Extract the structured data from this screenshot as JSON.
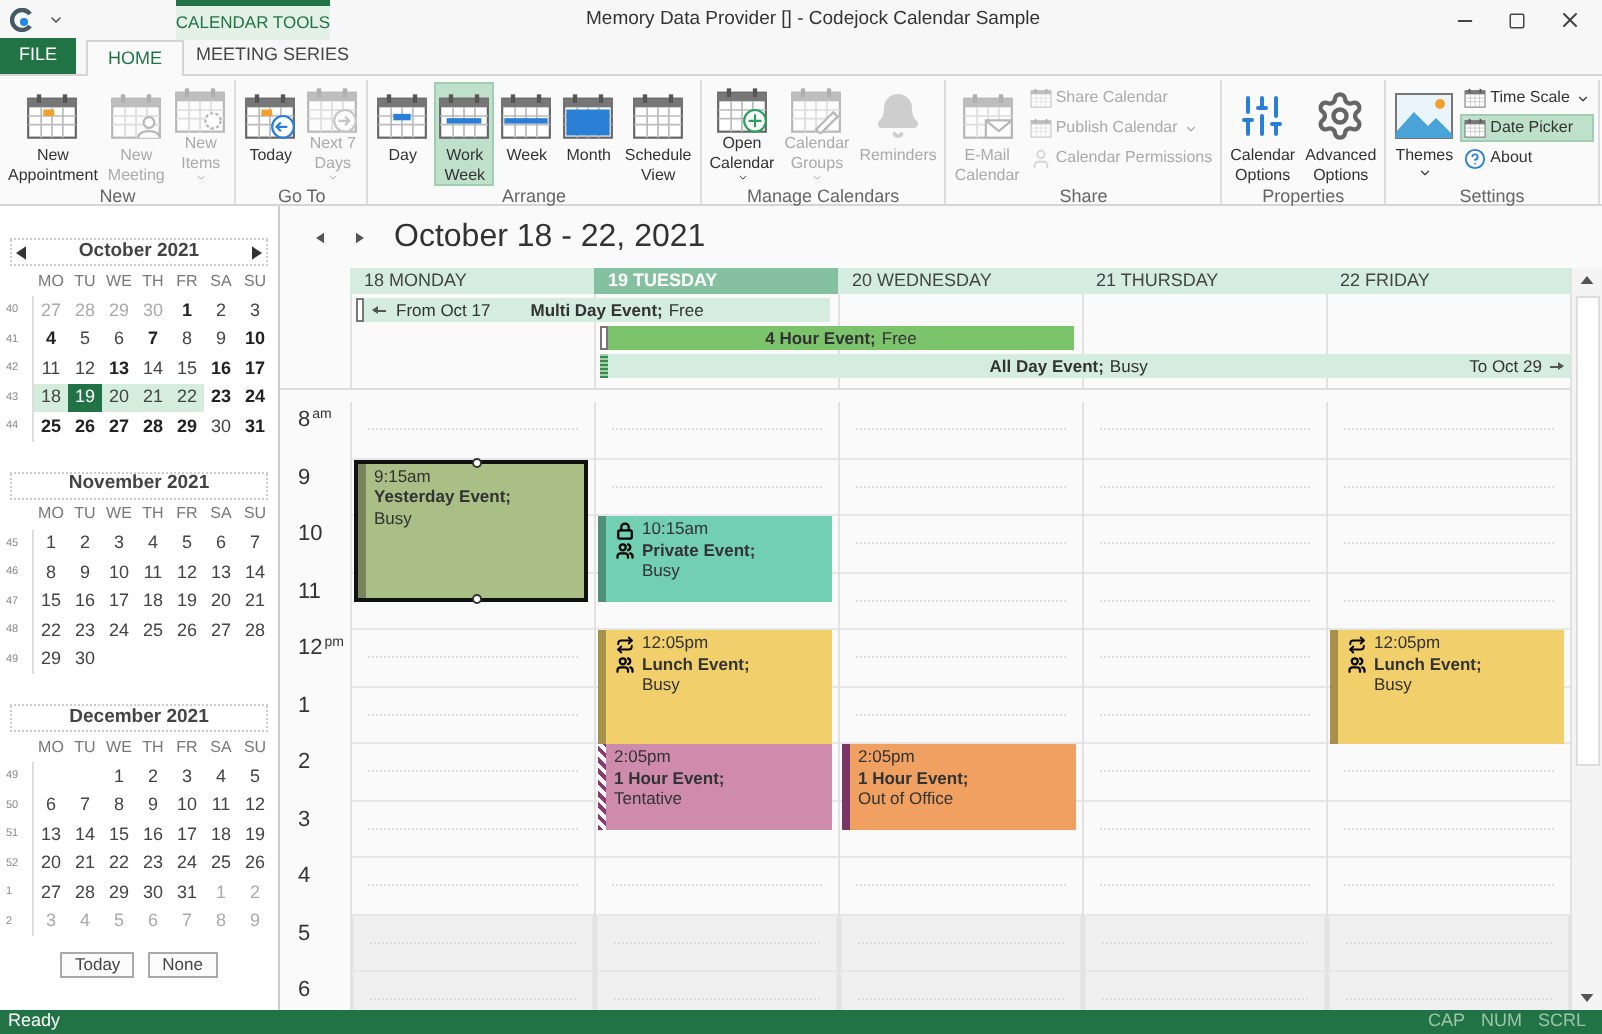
{
  "title_bar": {
    "title": "Memory Data Provider [] - Codejock Calendar Sample",
    "contextual_tab": "CALENDAR TOOLS"
  },
  "ribbon_tabs": [
    {
      "label": "FILE",
      "kind": "file",
      "selected": false
    },
    {
      "label": "HOME",
      "kind": "tab",
      "selected": true
    },
    {
      "label": "MEETING SERIES",
      "kind": "tab",
      "selected": false
    }
  ],
  "ribbon_groups": [
    {
      "label": "New",
      "buttons": [
        {
          "kind": "large",
          "lines": [
            "New",
            "Appointment"
          ],
          "disabled": false,
          "dropdown": false,
          "selected": false
        },
        {
          "kind": "large",
          "lines": [
            "New",
            "Meeting"
          ],
          "disabled": true,
          "dropdown": false,
          "selected": false
        },
        {
          "kind": "large",
          "lines": [
            "New",
            "Items"
          ],
          "disabled": true,
          "dropdown": true,
          "selected": false
        }
      ]
    },
    {
      "label": "Go To",
      "buttons": [
        {
          "kind": "large",
          "lines": [
            "Today"
          ],
          "disabled": false,
          "dropdown": false,
          "selected": false
        },
        {
          "kind": "large",
          "lines": [
            "Next 7",
            "Days"
          ],
          "disabled": true,
          "dropdown": true,
          "selected": false
        }
      ]
    },
    {
      "label": "Arrange",
      "buttons": [
        {
          "kind": "large",
          "lines": [
            "Day"
          ],
          "disabled": false,
          "dropdown": false,
          "selected": false
        },
        {
          "kind": "large",
          "lines": [
            "Work",
            "Week"
          ],
          "disabled": false,
          "dropdown": false,
          "selected": true
        },
        {
          "kind": "large",
          "lines": [
            "Week"
          ],
          "disabled": false,
          "dropdown": false,
          "selected": false
        },
        {
          "kind": "large",
          "lines": [
            "Month"
          ],
          "disabled": false,
          "dropdown": false,
          "selected": false
        },
        {
          "kind": "large",
          "lines": [
            "Schedule",
            "View"
          ],
          "disabled": false,
          "dropdown": false,
          "selected": false
        }
      ]
    },
    {
      "label": "Manage Calendars",
      "buttons": [
        {
          "kind": "large",
          "lines": [
            "Open",
            "Calendar"
          ],
          "disabled": false,
          "dropdown": true,
          "selected": false
        },
        {
          "kind": "large",
          "lines": [
            "Calendar",
            "Groups"
          ],
          "disabled": true,
          "dropdown": true,
          "selected": false
        },
        {
          "kind": "large",
          "lines": [
            "Reminders"
          ],
          "disabled": true,
          "dropdown": false,
          "selected": false
        }
      ]
    },
    {
      "label": "Share",
      "buttons": [
        {
          "kind": "large",
          "lines": [
            "E-Mail",
            "Calendar"
          ],
          "disabled": true,
          "dropdown": false,
          "selected": false
        },
        {
          "kind": "small",
          "lines": [
            "Share Calendar"
          ],
          "disabled": true,
          "dropdown": false,
          "selected": false
        },
        {
          "kind": "small",
          "lines": [
            "Publish Calendar"
          ],
          "disabled": true,
          "dropdown": true,
          "selected": false
        },
        {
          "kind": "small",
          "lines": [
            "Calendar Permissions"
          ],
          "disabled": true,
          "dropdown": false,
          "selected": false
        }
      ]
    },
    {
      "label": "Properties",
      "buttons": [
        {
          "kind": "large",
          "lines": [
            "Calendar",
            "Options"
          ],
          "disabled": false,
          "dropdown": false,
          "selected": false
        },
        {
          "kind": "large",
          "lines": [
            "Advanced",
            "Options"
          ],
          "disabled": false,
          "dropdown": false,
          "selected": false
        }
      ]
    },
    {
      "label": "Settings",
      "buttons": [
        {
          "kind": "large",
          "lines": [
            "Themes"
          ],
          "disabled": false,
          "dropdown": true,
          "selected": false
        },
        {
          "kind": "small",
          "lines": [
            "Time Scale"
          ],
          "disabled": false,
          "dropdown": true,
          "selected": false
        },
        {
          "kind": "small",
          "lines": [
            "Date Picker"
          ],
          "disabled": false,
          "dropdown": false,
          "selected": true
        },
        {
          "kind": "small",
          "lines": [
            "About"
          ],
          "disabled": false,
          "dropdown": false,
          "selected": false
        }
      ]
    }
  ],
  "date_picker": {
    "months": [
      {
        "title": "October 2021",
        "navigation": true,
        "weekdays": [
          "MO",
          "TU",
          "WE",
          "TH",
          "FR",
          "SA",
          "SU"
        ],
        "weeks": [
          {
            "number": "40",
            "selected": false,
            "days": [
              {
                "label": "27",
                "kind": "muted",
                "selected": false
              },
              {
                "label": "28",
                "kind": "muted",
                "selected": false
              },
              {
                "label": "29",
                "kind": "muted",
                "selected": false
              },
              {
                "label": "30",
                "kind": "muted",
                "selected": false
              },
              {
                "label": "1",
                "kind": "bold",
                "selected": false
              },
              {
                "label": "2",
                "kind": "plain",
                "selected": false
              },
              {
                "label": "3",
                "kind": "plain",
                "selected": false
              }
            ]
          },
          {
            "number": "41",
            "selected": false,
            "days": [
              {
                "label": "4",
                "kind": "bold",
                "selected": false
              },
              {
                "label": "5",
                "kind": "plain",
                "selected": false
              },
              {
                "label": "6",
                "kind": "plain",
                "selected": false
              },
              {
                "label": "7",
                "kind": "bold",
                "selected": false
              },
              {
                "label": "8",
                "kind": "plain",
                "selected": false
              },
              {
                "label": "9",
                "kind": "plain",
                "selected": false
              },
              {
                "label": "10",
                "kind": "bold",
                "selected": false
              }
            ]
          },
          {
            "number": "42",
            "selected": false,
            "days": [
              {
                "label": "11",
                "kind": "plain",
                "selected": false
              },
              {
                "label": "12",
                "kind": "plain",
                "selected": false
              },
              {
                "label": "13",
                "kind": "bold",
                "selected": false
              },
              {
                "label": "14",
                "kind": "plain",
                "selected": false
              },
              {
                "label": "15",
                "kind": "plain",
                "selected": false
              },
              {
                "label": "16",
                "kind": "bold",
                "selected": false
              },
              {
                "label": "17",
                "kind": "bold",
                "selected": false
              }
            ]
          },
          {
            "number": "43",
            "selected": true,
            "days": [
              {
                "label": "18",
                "kind": "plain",
                "selected": false
              },
              {
                "label": "19",
                "kind": "plain",
                "selected": true
              },
              {
                "label": "20",
                "kind": "plain",
                "selected": false
              },
              {
                "label": "21",
                "kind": "plain",
                "selected": false
              },
              {
                "label": "22",
                "kind": "plain",
                "selected": false
              },
              {
                "label": "23",
                "kind": "bold",
                "selected": false
              },
              {
                "label": "24",
                "kind": "bold",
                "selected": false
              }
            ]
          },
          {
            "number": "44",
            "selected": false,
            "days": [
              {
                "label": "25",
                "kind": "bold",
                "selected": false
              },
              {
                "label": "26",
                "kind": "bold",
                "selected": false
              },
              {
                "label": "27",
                "kind": "bold",
                "selected": false
              },
              {
                "label": "28",
                "kind": "bold",
                "selected": false
              },
              {
                "label": "29",
                "kind": "bold",
                "selected": false
              },
              {
                "label": "30",
                "kind": "plain",
                "selected": false
              },
              {
                "label": "31",
                "kind": "bold",
                "selected": false
              }
            ]
          }
        ]
      },
      {
        "title": "November 2021",
        "navigation": false,
        "weekdays": [
          "MO",
          "TU",
          "WE",
          "TH",
          "FR",
          "SA",
          "SU"
        ],
        "weeks": [
          {
            "number": "45",
            "selected": false,
            "days": [
              {
                "label": "1",
                "kind": "plain",
                "selected": false
              },
              {
                "label": "2",
                "kind": "plain",
                "selected": false
              },
              {
                "label": "3",
                "kind": "plain",
                "selected": false
              },
              {
                "label": "4",
                "kind": "plain",
                "selected": false
              },
              {
                "label": "5",
                "kind": "plain",
                "selected": false
              },
              {
                "label": "6",
                "kind": "plain",
                "selected": false
              },
              {
                "label": "7",
                "kind": "plain",
                "selected": false
              }
            ]
          },
          {
            "number": "46",
            "selected": false,
            "days": [
              {
                "label": "8",
                "kind": "plain",
                "selected": false
              },
              {
                "label": "9",
                "kind": "plain",
                "selected": false
              },
              {
                "label": "10",
                "kind": "plain",
                "selected": false
              },
              {
                "label": "11",
                "kind": "plain",
                "selected": false
              },
              {
                "label": "12",
                "kind": "plain",
                "selected": false
              },
              {
                "label": "13",
                "kind": "plain",
                "selected": false
              },
              {
                "label": "14",
                "kind": "plain",
                "selected": false
              }
            ]
          },
          {
            "number": "47",
            "selected": false,
            "days": [
              {
                "label": "15",
                "kind": "plain",
                "selected": false
              },
              {
                "label": "16",
                "kind": "plain",
                "selected": false
              },
              {
                "label": "17",
                "kind": "plain",
                "selected": false
              },
              {
                "label": "18",
                "kind": "plain",
                "selected": false
              },
              {
                "label": "19",
                "kind": "plain",
                "selected": false
              },
              {
                "label": "20",
                "kind": "plain",
                "selected": false
              },
              {
                "label": "21",
                "kind": "plain",
                "selected": false
              }
            ]
          },
          {
            "number": "48",
            "selected": false,
            "days": [
              {
                "label": "22",
                "kind": "plain",
                "selected": false
              },
              {
                "label": "23",
                "kind": "plain",
                "selected": false
              },
              {
                "label": "24",
                "kind": "plain",
                "selected": false
              },
              {
                "label": "25",
                "kind": "plain",
                "selected": false
              },
              {
                "label": "26",
                "kind": "plain",
                "selected": false
              },
              {
                "label": "27",
                "kind": "plain",
                "selected": false
              },
              {
                "label": "28",
                "kind": "plain",
                "selected": false
              }
            ]
          },
          {
            "number": "49",
            "selected": false,
            "days": [
              {
                "label": "29",
                "kind": "plain",
                "selected": false
              },
              {
                "label": "30",
                "kind": "plain",
                "selected": false
              }
            ]
          }
        ]
      },
      {
        "title": "December 2021",
        "navigation": false,
        "weekdays": [
          "MO",
          "TU",
          "WE",
          "TH",
          "FR",
          "SA",
          "SU"
        ],
        "weeks": [
          {
            "number": "49",
            "selected": false,
            "days": [
              {
                "kind": "blank"
              },
              {
                "kind": "blank"
              },
              {
                "label": "1",
                "kind": "plain",
                "selected": false
              },
              {
                "label": "2",
                "kind": "plain",
                "selected": false
              },
              {
                "label": "3",
                "kind": "plain",
                "selected": false
              },
              {
                "label": "4",
                "kind": "plain",
                "selected": false
              },
              {
                "label": "5",
                "kind": "plain",
                "selected": false
              }
            ]
          },
          {
            "number": "50",
            "selected": false,
            "days": [
              {
                "label": "6",
                "kind": "plain",
                "selected": false
              },
              {
                "label": "7",
                "kind": "plain",
                "selected": false
              },
              {
                "label": "8",
                "kind": "plain",
                "selected": false
              },
              {
                "label": "9",
                "kind": "plain",
                "selected": false
              },
              {
                "label": "10",
                "kind": "plain",
                "selected": false
              },
              {
                "label": "11",
                "kind": "plain",
                "selected": false
              },
              {
                "label": "12",
                "kind": "plain",
                "selected": false
              }
            ]
          },
          {
            "number": "51",
            "selected": false,
            "days": [
              {
                "label": "13",
                "kind": "plain",
                "selected": false
              },
              {
                "label": "14",
                "kind": "plain",
                "selected": false
              },
              {
                "label": "15",
                "kind": "plain",
                "selected": false
              },
              {
                "label": "16",
                "kind": "plain",
                "selected": false
              },
              {
                "label": "17",
                "kind": "plain",
                "selected": false
              },
              {
                "label": "18",
                "kind": "plain",
                "selected": false
              },
              {
                "label": "19",
                "kind": "plain",
                "selected": false
              }
            ]
          },
          {
            "number": "52",
            "selected": false,
            "days": [
              {
                "label": "20",
                "kind": "plain",
                "selected": false
              },
              {
                "label": "21",
                "kind": "plain",
                "selected": false
              },
              {
                "label": "22",
                "kind": "plain",
                "selected": false
              },
              {
                "label": "23",
                "kind": "plain",
                "selected": false
              },
              {
                "label": "24",
                "kind": "plain",
                "selected": false
              },
              {
                "label": "25",
                "kind": "plain",
                "selected": false
              },
              {
                "label": "26",
                "kind": "plain",
                "selected": false
              }
            ]
          },
          {
            "number": "1",
            "selected": false,
            "days": [
              {
                "label": "27",
                "kind": "plain",
                "selected": false
              },
              {
                "label": "28",
                "kind": "plain",
                "selected": false
              },
              {
                "label": "29",
                "kind": "plain",
                "selected": false
              },
              {
                "label": "30",
                "kind": "plain",
                "selected": false
              },
              {
                "label": "31",
                "kind": "plain",
                "selected": false
              },
              {
                "label": "1",
                "kind": "muted",
                "selected": false
              },
              {
                "label": "2",
                "kind": "muted",
                "selected": false
              }
            ]
          },
          {
            "number": "2",
            "selected": false,
            "days": [
              {
                "label": "3",
                "kind": "muted",
                "selected": false
              },
              {
                "label": "4",
                "kind": "muted",
                "selected": false
              },
              {
                "label": "5",
                "kind": "muted",
                "selected": false
              },
              {
                "label": "6",
                "kind": "muted",
                "selected": false
              },
              {
                "label": "7",
                "kind": "muted",
                "selected": false
              },
              {
                "label": "8",
                "kind": "muted",
                "selected": false
              },
              {
                "label": "9",
                "kind": "muted",
                "selected": false
              }
            ]
          }
        ]
      }
    ],
    "buttons": [
      "Today",
      "None"
    ]
  },
  "calendar": {
    "range_title": "October 18 - 22, 2021",
    "all_day_events": [
      {
        "kind": "multi_day",
        "from": "From Oct 17",
        "title": "Multi Day Event;",
        "status": "Free"
      },
      {
        "kind": "span",
        "title": "4 Hour Event;",
        "status": "Free"
      },
      {
        "kind": "all_day",
        "title": "All Day Event;",
        "status": "Busy",
        "to": "To Oct 29"
      }
    ],
    "hours": [
      {
        "label": "8",
        "suffix": "am",
        "working": true
      },
      {
        "label": "9",
        "working": true
      },
      {
        "label": "10",
        "working": true
      },
      {
        "label": "11",
        "working": true
      },
      {
        "label": "12",
        "suffix": "pm",
        "working": true
      },
      {
        "label": "1",
        "working": true
      },
      {
        "label": "2",
        "working": true
      },
      {
        "label": "3",
        "working": true
      },
      {
        "label": "4",
        "working": true
      },
      {
        "label": "5",
        "working": false
      },
      {
        "label": "6",
        "working": false
      }
    ],
    "days": [
      {
        "label": "18 MONDAY",
        "selected": false,
        "events": [
          {
            "time": "9:15am",
            "title": "Yesterday Event;",
            "status": "Busy",
            "kind": "busy",
            "color": "#a9bf85",
            "selected": true,
            "private": false,
            "recurring": false,
            "meeting": false
          }
        ]
      },
      {
        "label": "19 TUESDAY",
        "selected": true,
        "events": [
          {
            "time": "10:15am",
            "title": "Private Event;",
            "status": "Busy",
            "kind": "busy",
            "color": "#72cfb1",
            "selected": false,
            "private": true,
            "recurring": false,
            "meeting": true
          },
          {
            "time": "12:05pm",
            "title": "Lunch Event;",
            "status": "Busy",
            "kind": "busy",
            "color": "#f1d06b",
            "selected": false,
            "private": false,
            "recurring": true,
            "meeting": true
          },
          {
            "time": "2:05pm",
            "title": "1 Hour Event;",
            "status": "Tentative",
            "kind": "tentative",
            "color": "#cf8bab",
            "selected": false,
            "private": false,
            "recurring": false,
            "meeting": false
          }
        ]
      },
      {
        "label": "20 WEDNESDAY",
        "selected": false,
        "events": [
          {
            "time": "2:05pm",
            "title": "1 Hour Event;",
            "status": "Out of Office",
            "kind": "out_of_office",
            "color": "#f0a060",
            "selected": false,
            "private": false,
            "recurring": false,
            "meeting": false
          }
        ]
      },
      {
        "label": "21 THURSDAY",
        "selected": false
      },
      {
        "label": "22 FRIDAY",
        "selected": false,
        "events": [
          {
            "time": "12:05pm",
            "title": "Lunch Event;",
            "status": "Busy",
            "kind": "busy",
            "color": "#f1d06b",
            "selected": false,
            "private": false,
            "recurring": true,
            "meeting": true
          }
        ]
      }
    ]
  },
  "status_bar": {
    "text": "Ready",
    "indicators": [
      "CAP",
      "NUM",
      "SCRL"
    ]
  }
}
